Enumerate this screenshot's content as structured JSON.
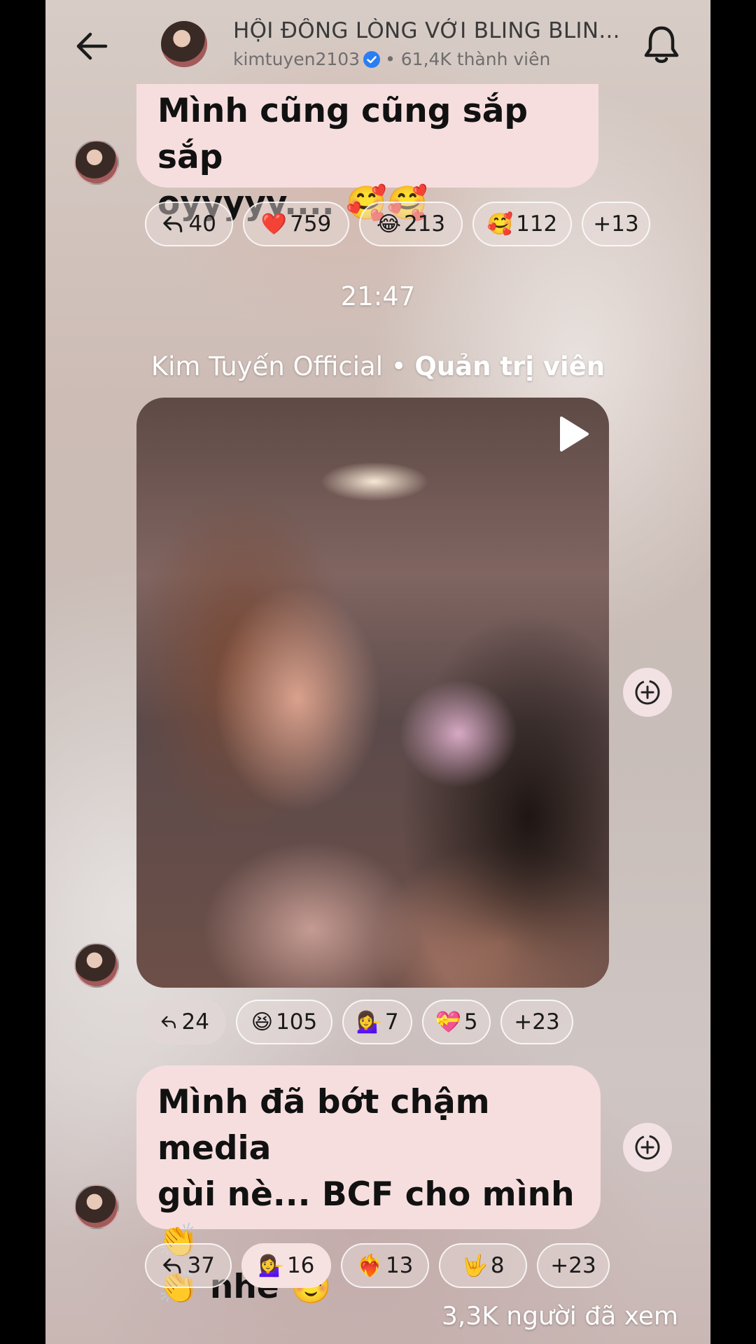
{
  "header": {
    "title": "HỘI ĐỒNG LÒNG VỚI BLING BLIN...",
    "username": "kimtuyen2103",
    "members": "• 61,4K thành viên"
  },
  "messages": [
    {
      "text_line1": "Mình cũng cũng sắp sắp",
      "text_line2": "oyyyyy.... 🥰🥰",
      "reactions": [
        {
          "icon": "reply-icon",
          "count": "40"
        },
        {
          "emoji": "❤️",
          "count": "759"
        },
        {
          "emoji": "😂",
          "count": "213"
        },
        {
          "emoji": "🥰",
          "count": "112"
        },
        {
          "count": "+13"
        }
      ]
    }
  ],
  "timestamp": "21:47",
  "author": {
    "name": "Kim Tuyến Official",
    "separator": " • ",
    "role": "Quản trị viên"
  },
  "video_post": {
    "reactions": [
      {
        "icon": "reply-icon",
        "count": "24"
      },
      {
        "emoji": "😆",
        "count": "105"
      },
      {
        "emoji": "💁‍♀️",
        "count": "7"
      },
      {
        "emoji": "💝",
        "count": "5"
      },
      {
        "count": "+23"
      }
    ]
  },
  "last_message": {
    "line1": "Mình đã bớt chậm media",
    "line2": "gùi nè... BCF cho mình 👏",
    "line3": "👏 nhé ☺️",
    "reactions": [
      {
        "icon": "reply-icon",
        "count": "37"
      },
      {
        "emoji": "💁‍♀️",
        "count": "16"
      },
      {
        "emoji": "❤️‍🔥",
        "count": "13"
      },
      {
        "emoji": "🤟",
        "count": "8"
      },
      {
        "count": "+23"
      }
    ]
  },
  "views": "3,3K người đã xem",
  "colors": {
    "bubble": "#f6dedf",
    "verified": "#2a7ef2"
  }
}
